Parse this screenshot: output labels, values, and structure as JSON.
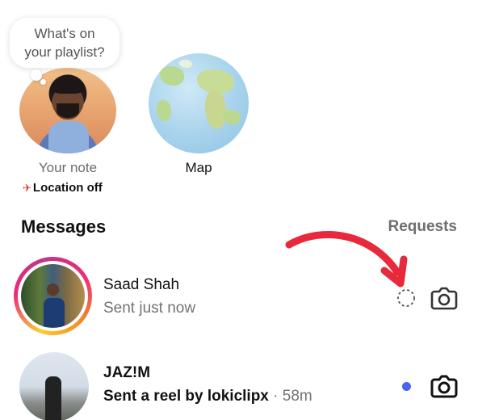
{
  "note": {
    "bubble_text_line1": "What's on",
    "bubble_text_line2": "your playlist?",
    "label": "Your note",
    "location_status": "Location off"
  },
  "map": {
    "label": "Map"
  },
  "header": {
    "title": "Messages",
    "requests_label": "Requests"
  },
  "threads": [
    {
      "name": "Saad Shah",
      "preview": "Sent just now",
      "status_icon": "loading-icon",
      "action_icon": "camera-icon"
    },
    {
      "name": "JAZ!M",
      "preview": "Sent a reel by lokiclipx",
      "separator": "·",
      "time": "58m",
      "unread": true,
      "action_icon": "camera-icon"
    }
  ],
  "colors": {
    "unread_dot": "#4a62f0",
    "annotation_arrow": "#e8293b",
    "location_pin": "#e53935"
  }
}
